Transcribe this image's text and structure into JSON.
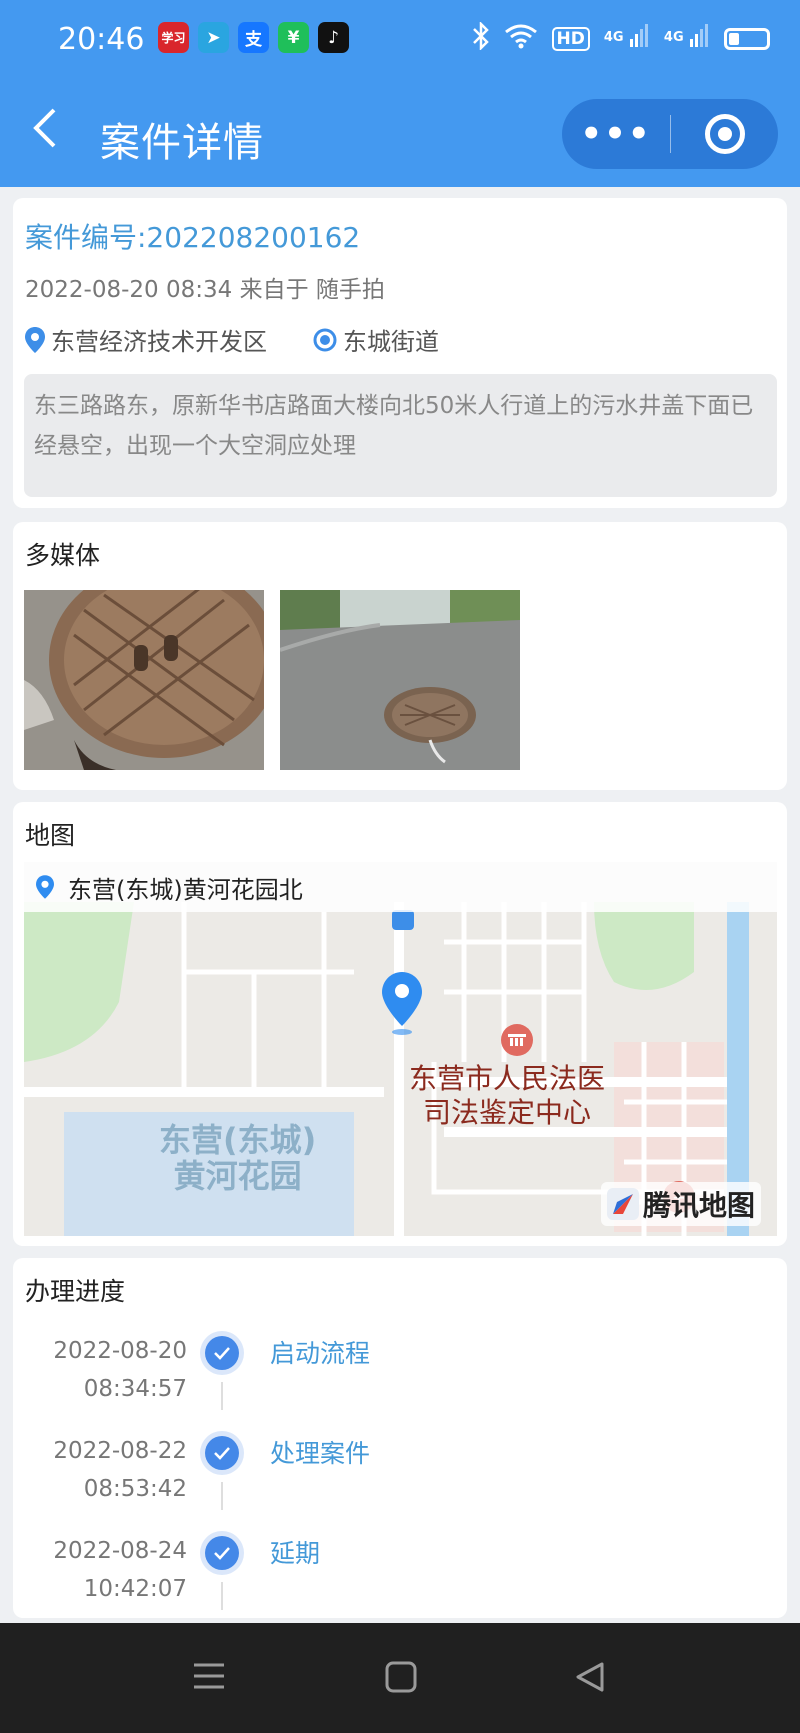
{
  "status_bar": {
    "time": "20:46",
    "apps": [
      {
        "name": "xuexi-app-icon",
        "glyph": "学习",
        "color": "#d9262c"
      },
      {
        "name": "telegram-app-icon",
        "glyph": "➤",
        "color": "#2aa5e0"
      },
      {
        "name": "alipay-app-icon",
        "glyph": "支",
        "color": "#1677ff"
      },
      {
        "name": "wechat-pay-app-icon",
        "glyph": "¥",
        "color": "#1fbf5a"
      },
      {
        "name": "tiktok-app-icon",
        "glyph": "♪",
        "color": "#111111"
      }
    ],
    "hd": "HD",
    "network1": "4G",
    "network2": "4G"
  },
  "navbar": {
    "back_glyph": "〈",
    "title": "案件详情",
    "more_glyph": "•••"
  },
  "case": {
    "number": "案件编号:202208200162",
    "meta": "2022-08-20 08:34 来自于 随手拍",
    "district": "东营经济技术开发区",
    "street": "东城街道",
    "description": "东三路路东，原新华书店路面大楼向北50米人行道上的污水井盖下面已经悬空，出现一个大空洞应处理"
  },
  "media": {
    "title": "多媒体",
    "photos": [
      "photo-manhole-closeup",
      "photo-manhole-road"
    ]
  },
  "map": {
    "title": "地图",
    "location": "东营(东城)黄河花园北",
    "poi_label_line1": "东营市人民法医",
    "poi_label_line2": "司法鉴定中心",
    "area_label_line1": "东营(东城)",
    "area_label_line2": "黄河花园",
    "provider": "腾讯地图"
  },
  "progress": {
    "title": "办理进度",
    "steps": [
      {
        "date": "2022-08-20",
        "time": "08:34:57",
        "label": "启动流程"
      },
      {
        "date": "2022-08-22",
        "time": "08:53:42",
        "label": "处理案件"
      },
      {
        "date": "2022-08-24",
        "time": "10:42:07",
        "label": "延期"
      }
    ]
  },
  "colors": {
    "header": "#4499f0",
    "accent_text": "#4499d8",
    "check": "#4488e8"
  }
}
